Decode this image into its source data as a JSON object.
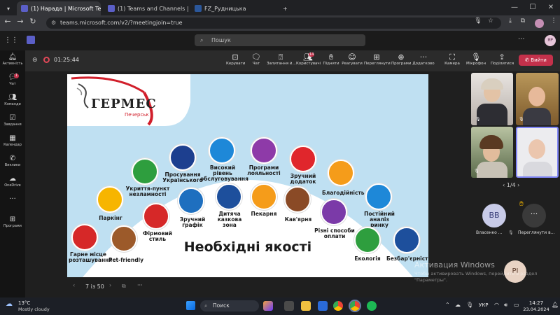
{
  "browser": {
    "tabs": [
      {
        "label": "(1) Нарада | Microsoft Tea",
        "active": true
      },
      {
        "label": "(1) Teams and Channels | Др",
        "active": false
      },
      {
        "label": "FZ_Рудницька",
        "active": false
      }
    ],
    "url": "teams.microsoft.com/v2/?meetingjoin=true"
  },
  "teams": {
    "search_placeholder": "Пошук",
    "avatar_initials": "ЯР"
  },
  "rail": [
    {
      "label": "Активність",
      "icon": "bell-icon"
    },
    {
      "label": "Чат",
      "icon": "chat-icon",
      "badge": "1"
    },
    {
      "label": "Команди",
      "icon": "teams-icon"
    },
    {
      "label": "Завдання",
      "icon": "tasks-icon"
    },
    {
      "label": "Календар",
      "icon": "calendar-icon"
    },
    {
      "label": "Виклики",
      "icon": "phone-icon"
    },
    {
      "label": "OneDrive",
      "icon": "cloud-icon"
    },
    {
      "label": "Програми",
      "icon": "apps-icon"
    }
  ],
  "meeting": {
    "timer": "01:25:44",
    "toolbar": [
      {
        "label": "Керувати",
        "icon": "manage-icon"
      },
      {
        "label": "Чат",
        "icon": "chat-icon"
      },
      {
        "label": "Запитання й...",
        "icon": "qa-icon"
      },
      {
        "label": "Користувачі",
        "icon": "people-icon",
        "badge": "14"
      },
      {
        "label": "Підняти",
        "icon": "hand-icon"
      },
      {
        "label": "Реагувати",
        "icon": "smile-icon"
      },
      {
        "label": "Переглянути",
        "icon": "view-icon"
      },
      {
        "label": "Програми",
        "icon": "apps-icon"
      },
      {
        "label": "Додатково",
        "icon": "more-icon"
      },
      {
        "label": "Камера",
        "icon": "camera-off-icon"
      },
      {
        "label": "Мікрофон",
        "icon": "mic-off-icon"
      },
      {
        "label": "Поділитися",
        "icon": "share-icon"
      }
    ],
    "leave_label": "Вийти",
    "slide_counter": "7 із 50",
    "participants_page": "1/4",
    "participants": [
      {
        "initials": "ВВ",
        "name": "Власенко ..."
      },
      {
        "initials": "",
        "name": "Переглянути в..."
      },
      {
        "initials": "PI",
        "name": ""
      }
    ]
  },
  "slide": {
    "logo_title": "ГЕРМЕС",
    "logo_subtitle": "Печерськ",
    "heading": "Необхідні якості",
    "items": [
      {
        "label": "Гарне місце розташування",
        "color": "#d62828"
      },
      {
        "label": "Паркінг",
        "color": "#f7b500"
      },
      {
        "label": "Укриття-пункт незламності",
        "color": "#2e9e3e"
      },
      {
        "label": "Pet-friendly",
        "color": "#9c5a2a"
      },
      {
        "label": "Фірмовий стиль",
        "color": "#d62828"
      },
      {
        "label": "Просування Українського",
        "color": "#1d3f8f"
      },
      {
        "label": "Зручний графік",
        "color": "#1e6fbf"
      },
      {
        "label": "Високий рівень обслуговування",
        "color": "#1e88d8"
      },
      {
        "label": "Дитяча казкова зона",
        "color": "#1d4f9c"
      },
      {
        "label": "Програми лояльності",
        "color": "#8e3aa8"
      },
      {
        "label": "Пекарня",
        "color": "#f59c1a"
      },
      {
        "label": "Зручний додаток",
        "color": "#e0262c"
      },
      {
        "label": "Кав'ярня",
        "color": "#8a4a26"
      },
      {
        "label": "Благодійність",
        "color": "#f59c1a"
      },
      {
        "label": "Різні способи оплати",
        "color": "#7b3aa8"
      },
      {
        "label": "Постійний аналіз ринку",
        "color": "#1e88d8"
      },
      {
        "label": "Екологія",
        "color": "#2e9e3e"
      },
      {
        "label": "Безбар'єрність",
        "color": "#1d4f9c"
      }
    ]
  },
  "windows": {
    "activation_title": "Активация Windows",
    "activation_text1": "Чтобы активировать Windows, перейдите в раздел",
    "activation_text2": "\"Параметры\"."
  },
  "taskbar": {
    "weather_temp": "13°C",
    "weather_desc": "Mostly cloudy",
    "search": "Поиск",
    "lang": "УКР",
    "time": "14:27",
    "date": "23.04.2024"
  }
}
